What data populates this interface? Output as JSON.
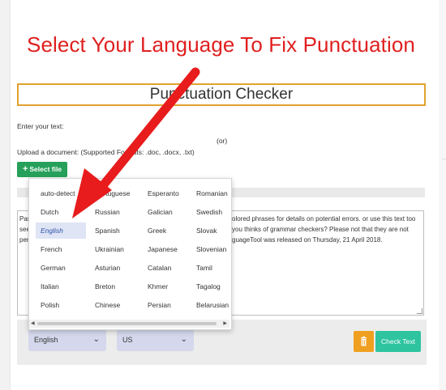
{
  "annotation": {
    "text": "Select Your Language To Fix Punctuation",
    "arrow_color": "#e81c1c"
  },
  "title": "Punctuation Checker",
  "form": {
    "enter_text_label": "Enter your text:",
    "or_label": "(or)",
    "upload_label": "Upload a document: (Supported Formats: .doc, .docx, .txt)",
    "select_file_label": "Select file"
  },
  "textarea": {
    "line1_start": "Pas",
    "line1_end": "olored phrases for details on potential errors. or use this text too",
    "line2_start": "see",
    "line2_end": "you thinks of grammar checkers? Please not that they are not",
    "line3_start": "per",
    "line3_end": "guageTool was released on Thursday, 21 April 2018."
  },
  "language_popup": {
    "options": [
      [
        "auto-detect",
        "Portuguese",
        "Esperanto",
        "Romanian"
      ],
      [
        "Dutch",
        "Russian",
        "Galician",
        "Swedish"
      ],
      [
        "English",
        "Spanish",
        "Greek",
        "Slovak"
      ],
      [
        "French",
        "Ukrainian",
        "Japanese",
        "Slovenian"
      ],
      [
        "German",
        "Asturian",
        "Catalan",
        "Tamil"
      ],
      [
        "Italian",
        "Breton",
        "Khmer",
        "Tagalog"
      ],
      [
        "Polish",
        "Chinese",
        "Persian",
        "Belarusian"
      ]
    ],
    "selected": "English"
  },
  "bottom": {
    "language_value": "English",
    "variant_value": "US",
    "check_label": "Check Text"
  },
  "icons": {
    "plus": "plus-icon",
    "trash": "trash-icon",
    "chevron": "chevron-down-icon"
  },
  "colors": {
    "title_border": "#e0a32f",
    "select_file_bg": "#26a05a",
    "check_bg": "#2ec4a0",
    "trash_bg": "#f0a020",
    "dropdown_bg": "#d5d8ec",
    "annotation": "#e02020"
  }
}
